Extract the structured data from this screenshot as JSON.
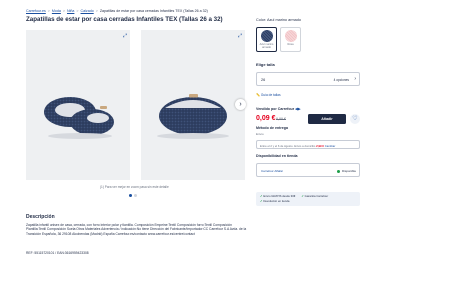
{
  "breadcrumb": {
    "items": [
      "Carrefour.es",
      "Moda",
      "Niña",
      "Calzado"
    ],
    "current": "Zapatillas de estar por casa cerradas Infantiles TEX (Tallas 26 a 32)",
    "sep": ">"
  },
  "product": {
    "title": "Zapatillas de estar por casa cerradas Infantiles TEX (Tallas 26 a 32)",
    "image_caption": "(1) Para ver mejor en zoom pasa sin este detalle",
    "images_count": 2,
    "active_image": 1
  },
  "color": {
    "label": "Color:",
    "value": "Azul marino armado",
    "swatches": [
      {
        "label": "Azul marino armado",
        "color": "#2d3f63",
        "selected": true
      },
      {
        "label": "Rosa",
        "color": "#f2c3c6",
        "selected": false
      }
    ]
  },
  "size": {
    "title": "Elige talla",
    "value": "26",
    "options": "4 opciones",
    "guide": "Guía de tallas"
  },
  "seller": {
    "label": "Vendido por Carrefour",
    "icon": "carrefour-logo-icon"
  },
  "price": {
    "current": "0,09 €",
    "old": "9,99 €",
    "add_label": "Añadir"
  },
  "delivery": {
    "title": "Método de entrega",
    "subtitle": "Envío",
    "text_prefix": "Entre el 2 y el 6 de Agosto. Envío a domicilio",
    "price": "2,99 €",
    "action": "Cambiar"
  },
  "availability": {
    "title": "Disponibilidad en tienda",
    "store": "Carrefour Alfafar",
    "status": "Disponible"
  },
  "benefits": {
    "free_shipping": "Envío GRATIS desde 30€",
    "guarantee": "Garantía Carrefour",
    "returns": "Devolución en tienda"
  },
  "description": {
    "title": "Descripción",
    "text": "Zapatilla infantil unisex de casa, cerrada, con forro interior polar y tlantilla. Composición Empeine:Textil Composición forro:Textil Composición Plantilla:Textil Composición Suela:Otros Materiales Advertencia / indicación:No tiene Dirección del Fabricante/Importador:CC Carrefour S.A Avda. de la Transición Española, 36 29108 Alcobendas (Madrid) España Carrefour.es/contacto www.carrefour.es/centre/contact",
    "ref": "REF: 55115720101 / EAN:3616959423308"
  },
  "colors": {
    "primary": "#1f2a44",
    "link": "#1a4fa0",
    "price": "#e6001e",
    "success": "#1e9e4a"
  }
}
